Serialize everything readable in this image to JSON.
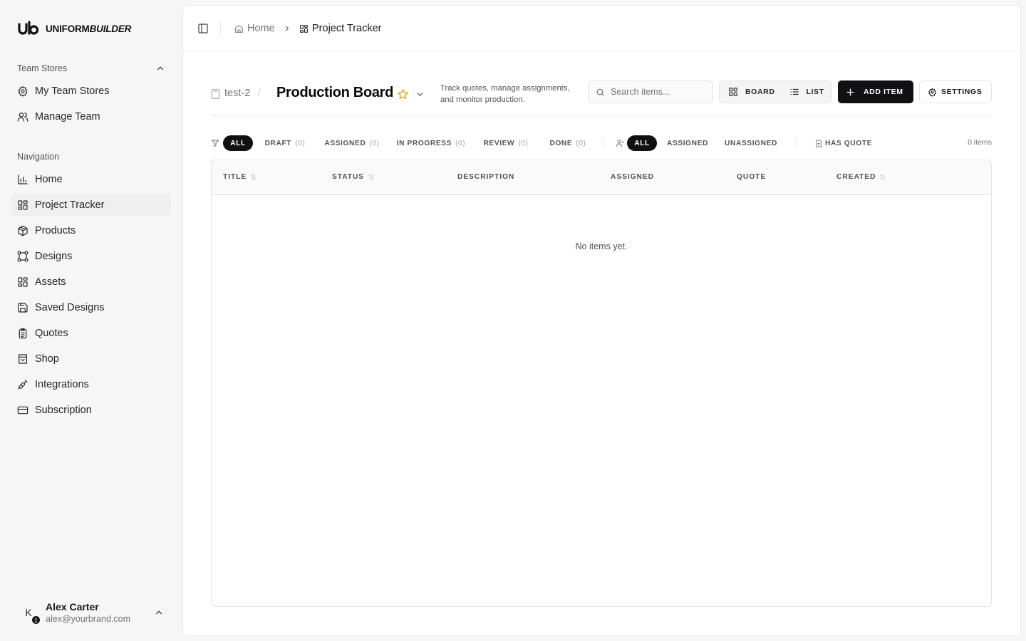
{
  "brand": {
    "logo_text": "ub",
    "name_plain": "UNIFORM",
    "name_italic": "BUILDER"
  },
  "sidebar": {
    "team_section_label": "Team Stores",
    "team_items": [
      {
        "label": "My Team Stores",
        "icon": "gear-icon"
      },
      {
        "label": "Manage Team",
        "icon": "users-icon"
      }
    ],
    "nav_section_label": "Navigation",
    "nav_items": [
      {
        "label": "Home",
        "icon": "bar-chart-icon"
      },
      {
        "label": "Project Tracker",
        "icon": "grid-icon",
        "active": true
      },
      {
        "label": "Products",
        "icon": "package-icon"
      },
      {
        "label": "Designs",
        "icon": "frame-icon"
      },
      {
        "label": "Assets",
        "icon": "grid-icon"
      },
      {
        "label": "Saved Designs",
        "icon": "save-icon"
      },
      {
        "label": "Quotes",
        "icon": "clipboard-icon"
      },
      {
        "label": "Shop",
        "icon": "store-icon"
      },
      {
        "label": "Integrations",
        "icon": "plug-icon"
      },
      {
        "label": "Subscription",
        "icon": "credit-card-icon"
      }
    ],
    "user": {
      "initial": "K",
      "badge": "1",
      "name": "Alex Carter",
      "email": "alex@yourbrand.com"
    }
  },
  "breadcrumb": {
    "home": "Home",
    "current": "Project Tracker"
  },
  "page": {
    "store": "test-2",
    "slash": "/",
    "title": "Production Board",
    "description": "Track quotes, manage assignments, and monitor production.",
    "search_placeholder": "Search items...",
    "search_value": "",
    "view_board": "BOARD",
    "view_list": "LIST",
    "add_item": "ADD ITEM",
    "settings": "SETTINGS"
  },
  "filters": {
    "status": [
      {
        "label": "ALL",
        "count": "",
        "active": true
      },
      {
        "label": "DRAFT",
        "count": "(0)"
      },
      {
        "label": "ASSIGNED",
        "count": "(0)"
      },
      {
        "label": "IN PROGRESS",
        "count": "(0)"
      },
      {
        "label": "REVIEW",
        "count": "(0)"
      },
      {
        "label": "DONE",
        "count": "(0)"
      }
    ],
    "assignee": [
      {
        "label": "ALL",
        "active": true
      },
      {
        "label": "ASSIGNED"
      },
      {
        "label": "UNASSIGNED"
      }
    ],
    "has_quote": "HAS QUOTE",
    "item_count": "0 items"
  },
  "table": {
    "columns": [
      {
        "label": "TITLE",
        "sortable": true
      },
      {
        "label": "STATUS",
        "sortable": true
      },
      {
        "label": "DESCRIPTION",
        "sortable": false
      },
      {
        "label": "ASSIGNED",
        "sortable": false
      },
      {
        "label": "QUOTE",
        "sortable": false
      },
      {
        "label": "CREATED",
        "sortable": true
      }
    ],
    "empty_message": "No items yet."
  },
  "colors": {
    "accent": "#111113",
    "star": "#e0a526",
    "background": "#f6f6f7"
  }
}
